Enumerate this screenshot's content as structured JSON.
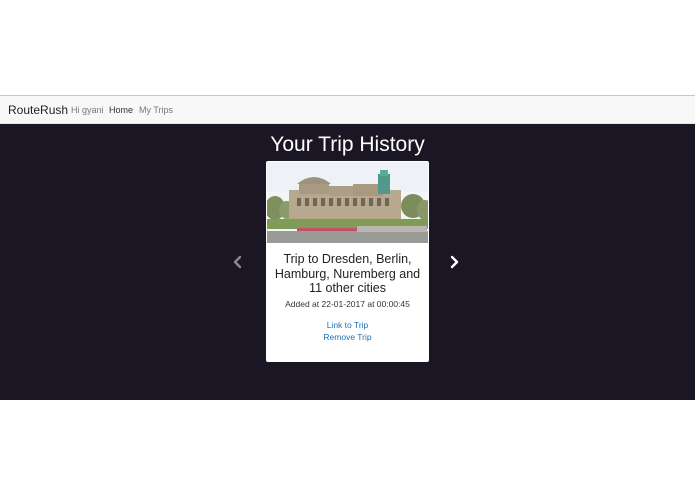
{
  "navbar": {
    "brand": "RouteRush",
    "greeting": "Hi gyani",
    "home_label": "Home",
    "trips_label": "My Trips"
  },
  "hero": {
    "title": "Your Trip History"
  },
  "carousel": {
    "prev_icon": "chevron-left-icon",
    "next_icon": "chevron-right-icon",
    "active_card": {
      "image": "dresden-semperoper-photo",
      "title": "Trip to Dresden, Berlin, Hamburg, Nuremberg and 11 other cities",
      "added": "Added at 22-01-2017 at 00:00:45",
      "link_label": "Link to Trip",
      "remove_label": "Remove Trip"
    }
  },
  "colors": {
    "hero_background": "#1b1623",
    "navbar_background": "#f8f8f8",
    "link": "#1e6fb5"
  }
}
